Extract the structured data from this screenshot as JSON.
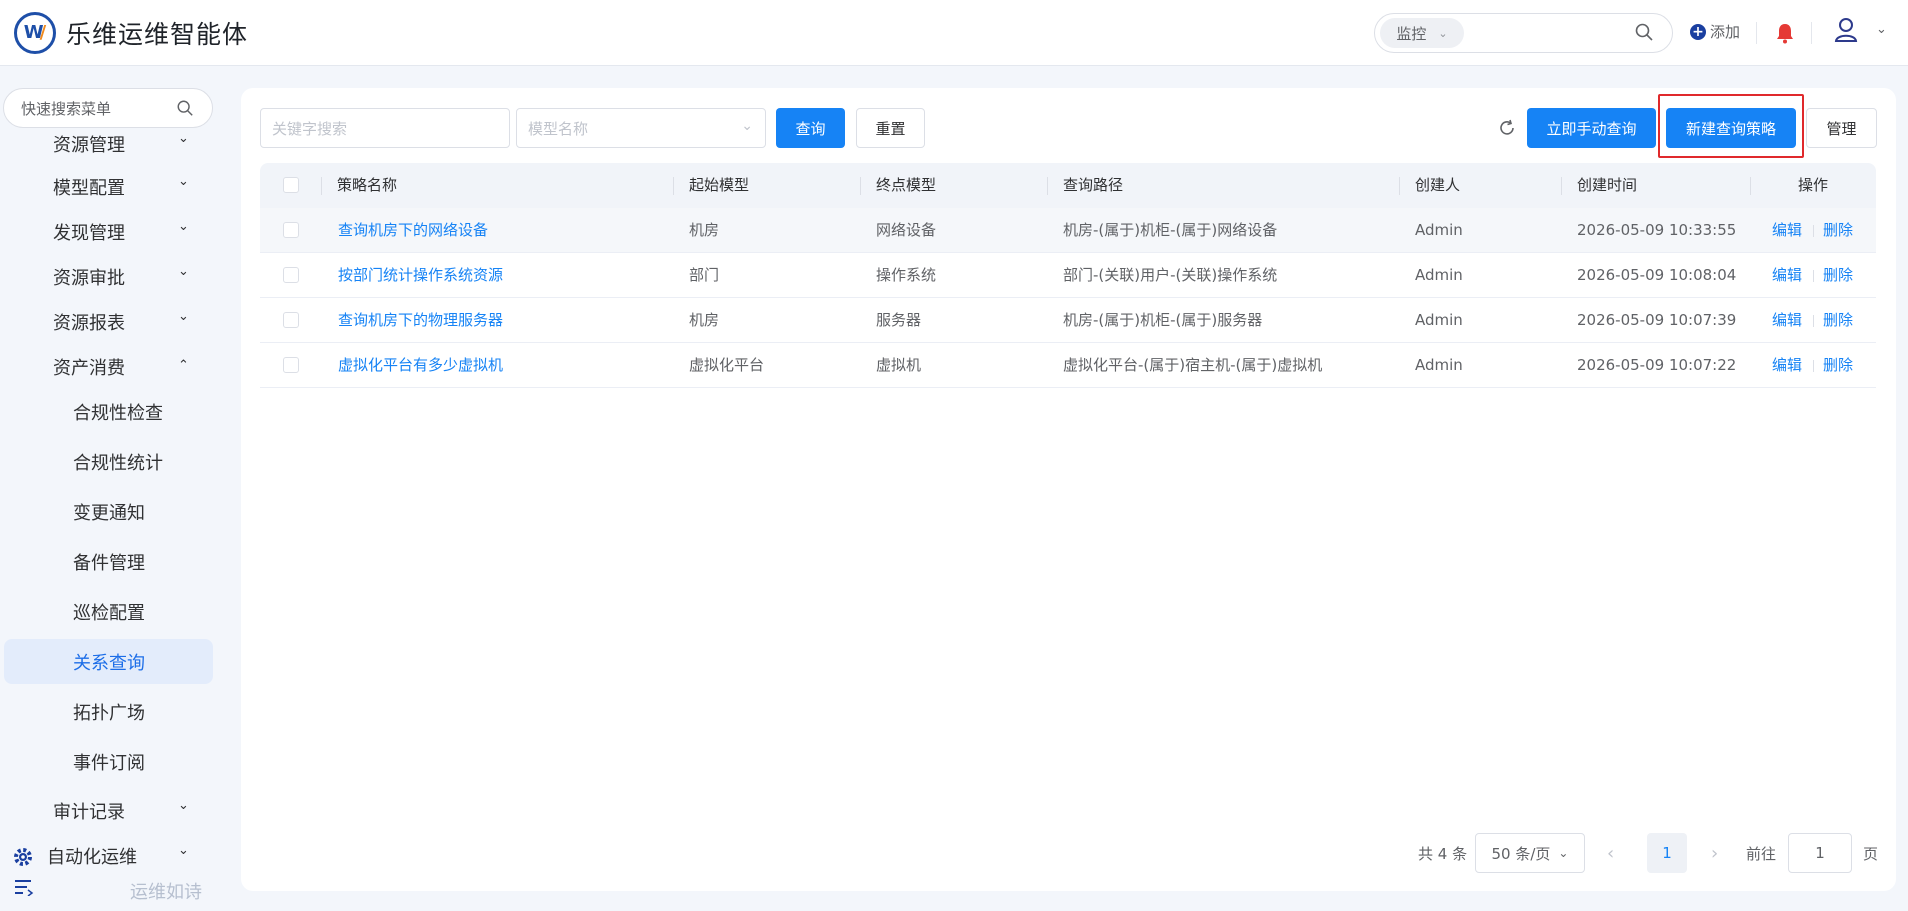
{
  "app": {
    "title": "乐维运维智能体"
  },
  "header": {
    "search_scope": "监控",
    "add_label": "添加"
  },
  "sidebar": {
    "search_placeholder": "快速搜索菜单",
    "items": [
      {
        "label": "资源管理",
        "arrow": "⌄"
      },
      {
        "label": "模型配置",
        "arrow": "⌄"
      },
      {
        "label": "发现管理",
        "arrow": "⌄"
      },
      {
        "label": "资源审批",
        "arrow": "⌄"
      },
      {
        "label": "资源报表",
        "arrow": "⌄"
      },
      {
        "label": "资产消费",
        "arrow": "⌃"
      }
    ],
    "sub_items": [
      {
        "label": "合规性检查"
      },
      {
        "label": "合规性统计"
      },
      {
        "label": "变更通知"
      },
      {
        "label": "备件管理"
      },
      {
        "label": "巡检配置"
      },
      {
        "label": "关系查询"
      },
      {
        "label": "拓扑广场"
      },
      {
        "label": "事件订阅"
      }
    ],
    "after_items": [
      {
        "label": "审计记录",
        "arrow": "⌄"
      },
      {
        "label": "自动化运维",
        "arrow": "⌄"
      }
    ],
    "footer": "运维如诗"
  },
  "toolbar": {
    "keyword_placeholder": "关键字搜索",
    "model_placeholder": "模型名称",
    "query_label": "查询",
    "reset_label": "重置",
    "manual_query_label": "立即手动查询",
    "new_policy_label": "新建查询策略",
    "manage_label": "管理"
  },
  "table": {
    "columns": [
      "策略名称",
      "起始模型",
      "终点模型",
      "查询路径",
      "创建人",
      "创建时间",
      "操作"
    ],
    "rows": [
      {
        "name": "查询机房下的网络设备",
        "start": "机房",
        "end": "网络设备",
        "path": "机房-(属于)机柜-(属于)网络设备",
        "creator": "Admin",
        "time": "2026-05-09 10:33:55"
      },
      {
        "name": "按部门统计操作系统资源",
        "start": "部门",
        "end": "操作系统",
        "path": "部门-(关联)用户-(关联)操作系统",
        "creator": "Admin",
        "time": "2026-05-09 10:08:04"
      },
      {
        "name": "查询机房下的物理服务器",
        "start": "机房",
        "end": "服务器",
        "path": "机房-(属于)机柜-(属于)服务器",
        "creator": "Admin",
        "time": "2026-05-09 10:07:39"
      },
      {
        "name": "虚拟化平台有多少虚拟机",
        "start": "虚拟化平台",
        "end": "虚拟机",
        "path": "虚拟化平台-(属于)宿主机-(属于)虚拟机",
        "creator": "Admin",
        "time": "2026-05-09 10:07:22"
      }
    ],
    "edit_label": "编辑",
    "delete_label": "删除"
  },
  "pagination": {
    "total_label": "共 4 条",
    "page_size": "50 条/页",
    "current_page": "1",
    "goto_label": "前往",
    "goto_value": "1",
    "page_suffix": "页"
  },
  "colors": {
    "primary": "#1683f5",
    "highlight": "#e0292c",
    "bell": "#e53935",
    "logo": "#1e4fa8"
  }
}
